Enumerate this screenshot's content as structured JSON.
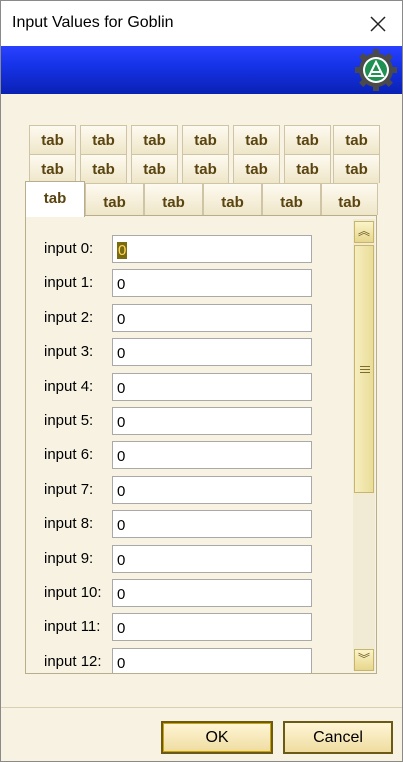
{
  "window": {
    "title": "Input Values for Goblin"
  },
  "icons": {
    "close": "close-icon",
    "logo": "gear-logo-icon"
  },
  "tabs": {
    "row1": [
      "tab",
      "tab",
      "tab",
      "tab",
      "tab",
      "tab",
      "tab"
    ],
    "row2": [
      "tab",
      "tab",
      "tab",
      "tab",
      "tab",
      "tab",
      "tab"
    ],
    "row3": [
      "tab",
      "tab",
      "tab",
      "tab",
      "tab",
      "tab"
    ],
    "active_index": 0
  },
  "inputs": [
    {
      "label": "input 0:",
      "value": "0"
    },
    {
      "label": "input 1:",
      "value": "0"
    },
    {
      "label": "input 2:",
      "value": "0"
    },
    {
      "label": "input 3:",
      "value": "0"
    },
    {
      "label": "input 4:",
      "value": "0"
    },
    {
      "label": "input 5:",
      "value": "0"
    },
    {
      "label": "input 6:",
      "value": "0"
    },
    {
      "label": "input 7:",
      "value": "0"
    },
    {
      "label": "input 8:",
      "value": "0"
    },
    {
      "label": "input 9:",
      "value": "0"
    },
    {
      "label": "input 10:",
      "value": "0"
    },
    {
      "label": "input 11:",
      "value": "0"
    },
    {
      "label": "input 12:",
      "value": "0"
    }
  ],
  "buttons": {
    "ok": "OK",
    "cancel": "Cancel"
  },
  "colors": {
    "banner": "#1633e8",
    "tab_text": "#5a4410",
    "panel_bg": "#f7f2e2"
  }
}
